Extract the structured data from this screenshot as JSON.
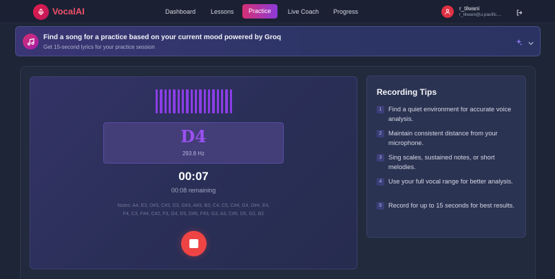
{
  "app": {
    "name": "VocalAI",
    "accent": "#ef4f6a"
  },
  "nav": {
    "links": [
      "Dashboard",
      "Lessons",
      "Practice",
      "Live Coach",
      "Progress"
    ],
    "active": "Practice",
    "active_gradient": [
      "#d62f74",
      "#8b3bd8"
    ]
  },
  "user": {
    "name": "r_tilwani",
    "email": "r_tilwani@u.pacific...."
  },
  "banner": {
    "title": "Find a song for a practice based on your current mood powered by Groq",
    "subtitle": "Get 15-second lyrics for your practice session",
    "icon": "music-note-icon"
  },
  "recorder": {
    "note": "D4",
    "frequency": "293.8 Hz",
    "timer": "00:07",
    "remaining": "00:08 remaining",
    "notes_line1": "Notes: A4, E3, D#3, C#3, D3, G#3, A#3, B3, C4, C5, C#4, D4, D#4, E4,",
    "notes_line2": "F4, C3, F#4, C#2, F3, G4, E5, D#5, F#3, G3, A3, C#5, D5, G2, B2",
    "waveform_bars": 18,
    "stop_color": "#ef4444"
  },
  "tips": {
    "title": "Recording Tips",
    "items": [
      {
        "num": "1",
        "text": "Find a quiet environment for accurate voice analysis."
      },
      {
        "num": "2",
        "text": "Maintain consistent distance from your microphone."
      },
      {
        "num": "3",
        "text": "Sing scales, sustained notes, or short melodies."
      },
      {
        "num": "4",
        "text": "Use your full vocal range for better analysis."
      },
      {
        "num": "5",
        "text": "Record for up to 15 seconds for best results."
      }
    ]
  }
}
